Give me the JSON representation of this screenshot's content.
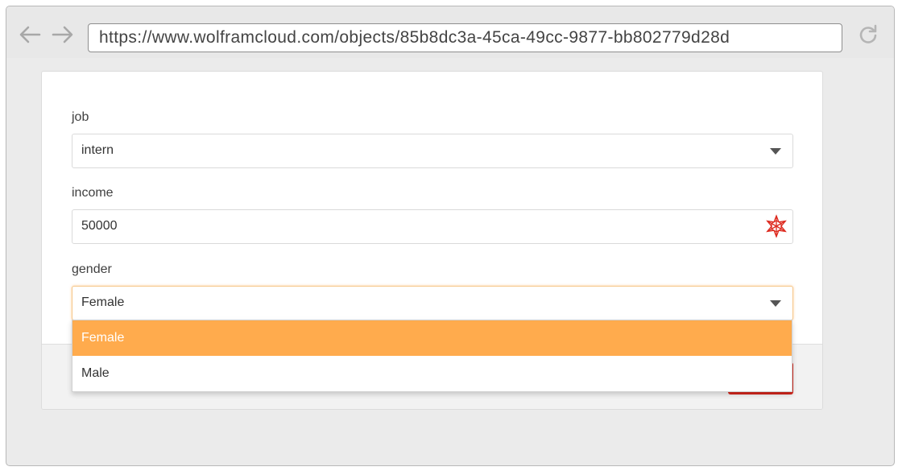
{
  "browser": {
    "url": "https://www.wolframcloud.com/objects/85b8dc3a-45ca-49cc-9877-bb802779d28d",
    "back_icon": "arrow-left-icon",
    "forward_icon": "arrow-right-icon",
    "reload_icon": "reload-icon"
  },
  "form": {
    "fields": [
      {
        "label": "job",
        "value": "intern",
        "type": "select"
      },
      {
        "label": "income",
        "value": "50000",
        "type": "text",
        "icon": "wolfram-spikey-icon"
      },
      {
        "label": "gender",
        "value": "Female",
        "type": "select"
      }
    ],
    "submit_color": "#d6271d"
  },
  "dropdown": {
    "options": [
      "Female",
      "Male"
    ],
    "selected": "Female",
    "highlight_color": "#ffab4d"
  }
}
